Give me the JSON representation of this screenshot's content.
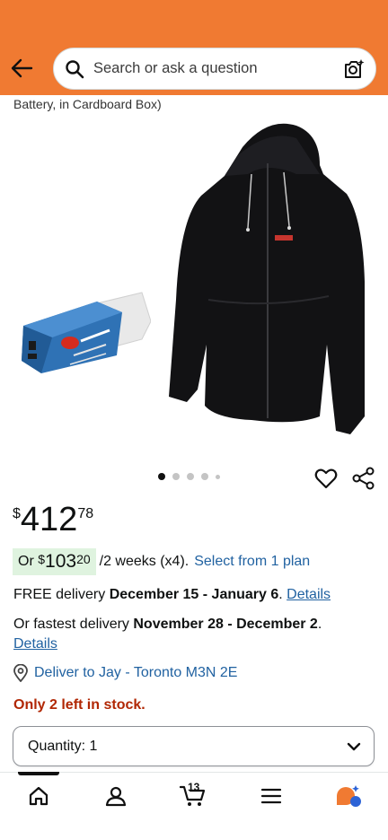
{
  "header": {
    "bg_color": "#f07a32",
    "back_icon": "arrow-left-icon",
    "search_placeholder": "Search or ask a question",
    "camera_icon": "camera-sparkle-icon"
  },
  "product": {
    "title_fragment": "Battery, in Cardboard Box)",
    "image_count": 5,
    "active_image": 0,
    "price": {
      "symbol": "$",
      "whole": "412",
      "fraction": "78"
    },
    "plan": {
      "prefix": "Or ",
      "symbol": "$",
      "whole": "103",
      "fraction": "20",
      "suffix": "/2 weeks (x4).",
      "link": "Select from 1 plan"
    },
    "delivery": {
      "prefix": "FREE delivery ",
      "dates": "December 15 - January 6",
      "period": ". ",
      "link": "Details"
    },
    "fastest": {
      "prefix": "Or fastest delivery ",
      "dates": "November 28 - December 2",
      "period": ".",
      "link": "Details"
    },
    "deliver_to": "Deliver to Jay - Toronto M3N 2E",
    "stock": "Only 2 left in stock.",
    "quantity": {
      "label": "Quantity: ",
      "value": "1"
    }
  },
  "bottom_nav": {
    "cart_count": "13",
    "items": [
      "home-icon",
      "account-icon",
      "cart-icon",
      "menu-icon",
      "rufus-icon"
    ]
  }
}
